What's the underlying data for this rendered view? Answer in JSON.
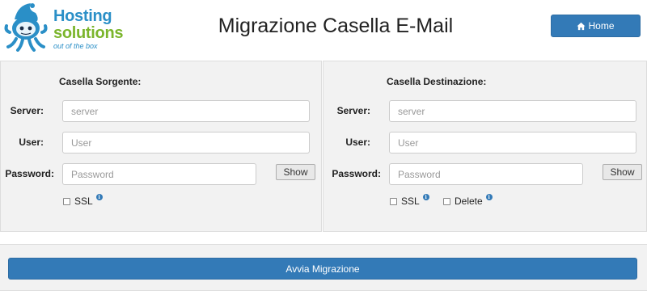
{
  "logo": {
    "line1": "Hosting",
    "line2": "solutions",
    "tagline": "out of the box"
  },
  "header": {
    "title": "Migrazione Casella E-Mail",
    "home_label": "Home",
    "home_icon": "home-icon"
  },
  "source": {
    "title": "Casella Sorgente:",
    "server_label": "Server:",
    "server_placeholder": "server",
    "user_label": "User:",
    "user_placeholder": "User",
    "password_label": "Password:",
    "password_placeholder": "Password",
    "show_label": "Show",
    "ssl_label": "SSL"
  },
  "destination": {
    "title": "Casella Destinazione:",
    "server_label": "Server:",
    "server_placeholder": "server",
    "user_label": "User:",
    "user_placeholder": "User",
    "password_label": "Password:",
    "password_placeholder": "Password",
    "show_label": "Show",
    "ssl_label": "SSL",
    "delete_label": "Delete"
  },
  "action": {
    "start_label": "Avvia Migrazione"
  },
  "colors": {
    "primary": "#337ab7",
    "logo_blue": "#2a8fc7",
    "logo_green": "#7bb52c",
    "panel_bg": "#f2f2f2"
  }
}
